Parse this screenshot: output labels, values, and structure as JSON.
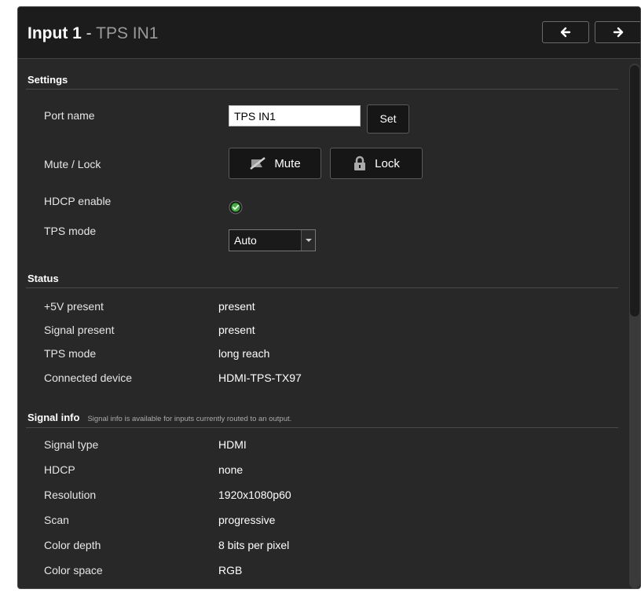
{
  "header": {
    "title_main": "Input 1",
    "title_separator": " - ",
    "title_sub": "TPS IN1",
    "prev_icon": "arrow-left-icon",
    "next_icon": "arrow-right-icon",
    "prev_glyph": "🡐",
    "next_glyph": "🡒"
  },
  "settings": {
    "title": "Settings",
    "port_name_label": "Port name",
    "port_name_value": "TPS IN1",
    "set_label": "Set",
    "mute_lock_label": "Mute / Lock",
    "mute_label": "Mute",
    "lock_label": "Lock",
    "hdcp_label": "HDCP enable",
    "hdcp_enabled": true,
    "tps_mode_label": "TPS mode",
    "tps_mode_value": "Auto"
  },
  "status": {
    "title": "Status",
    "rows": [
      {
        "label": "+5V present",
        "value": "present"
      },
      {
        "label": "Signal present",
        "value": "present"
      },
      {
        "label": "TPS mode",
        "value": "long reach"
      },
      {
        "label": "Connected device",
        "value": "HDMI-TPS-TX97"
      }
    ]
  },
  "signal_info": {
    "title": "Signal info",
    "note": "Signal info is available for inputs currently routed to an output.",
    "rows": [
      {
        "label": "Signal type",
        "value": "HDMI"
      },
      {
        "label": "HDCP",
        "value": "none"
      },
      {
        "label": "Resolution",
        "value": "1920x1080p60"
      },
      {
        "label": "Scan",
        "value": "progressive"
      },
      {
        "label": "Color depth",
        "value": "8 bits per pixel"
      },
      {
        "label": "Color space",
        "value": "RGB"
      }
    ]
  },
  "colors": {
    "panel_bg": "#282828",
    "header_bg": "#1c1c1c",
    "check_green": "#3fb23f"
  }
}
